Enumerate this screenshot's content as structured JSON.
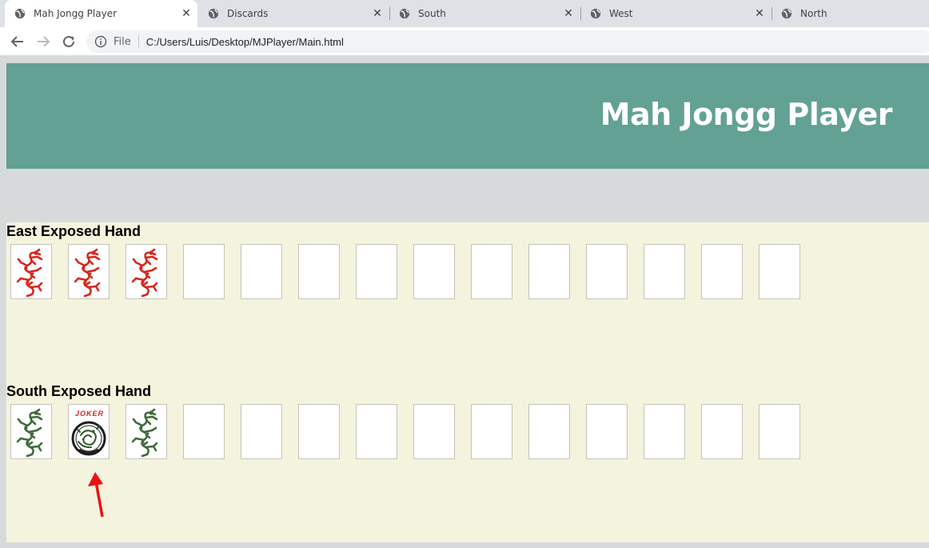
{
  "browser": {
    "tabs": [
      {
        "label": "Mah Jongg Player",
        "active": true
      },
      {
        "label": "Discards",
        "active": false
      },
      {
        "label": "South",
        "active": false
      },
      {
        "label": "West",
        "active": false
      },
      {
        "label": "North",
        "active": false
      }
    ],
    "address": {
      "scheme": "File",
      "url": "C:/Users/Luis/Desktop/MJPlayer/Main.html"
    }
  },
  "header": {
    "title": "Mah Jongg Player",
    "color": "#62a194"
  },
  "east": {
    "label": "East Exposed Hand",
    "tiles": [
      "red-dragon",
      "red-dragon",
      "red-dragon",
      "",
      "",
      "",
      "",
      "",
      "",
      "",
      "",
      "",
      "",
      ""
    ]
  },
  "south": {
    "label": "South Exposed Hand",
    "tiles": [
      "green-dragon",
      "joker",
      "green-dragon",
      "",
      "",
      "",
      "",
      "",
      "",
      "",
      "",
      "",
      "",
      ""
    ],
    "joker_text": "JOKER"
  },
  "colors": {
    "red_dragon": "#d8261c",
    "green_dragon": "#3f6b3a",
    "arrow": "#ee1111",
    "table": "#f4f4de"
  }
}
